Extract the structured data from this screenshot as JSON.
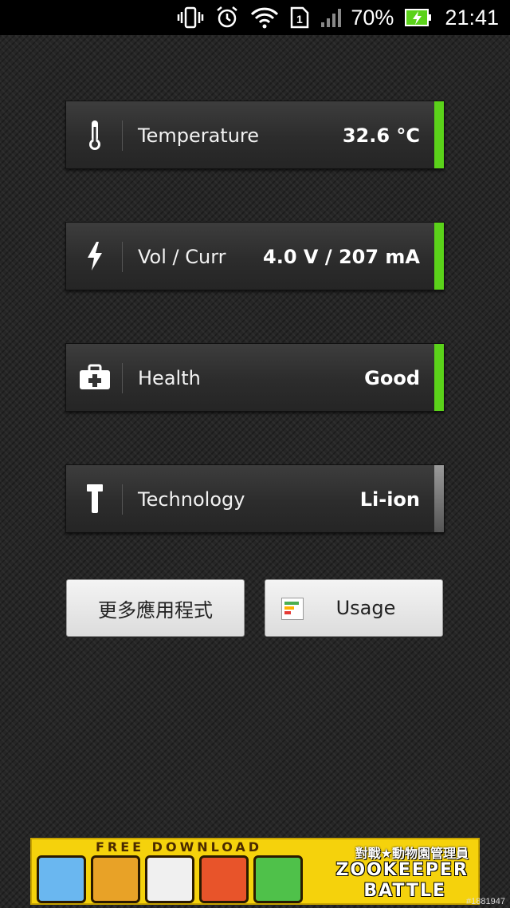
{
  "statusbar": {
    "signal_sim": "1",
    "battery_percent": "70%",
    "clock": "21:41",
    "icons": [
      "vibrate-icon",
      "alarm-icon",
      "wifi-icon",
      "sim-icon",
      "signal-icon",
      "battery-charging-icon"
    ]
  },
  "cards": [
    {
      "label": "Temperature",
      "value": "32.6 °C",
      "icon": "thermometer-icon",
      "bar_color": "#5bd21a"
    },
    {
      "label": "Vol / Curr",
      "value": "4.0 V / 207 mA",
      "icon": "lightning-icon",
      "bar_color": "#5bd21a"
    },
    {
      "label": "Health",
      "value": "Good",
      "icon": "first-aid-icon",
      "bar_color": "#5bd21a"
    },
    {
      "label": "Technology",
      "value": "Li-ion",
      "icon": "hammer-icon",
      "bar_color": "#8a8a8a"
    }
  ],
  "buttons": {
    "more_apps": "更多應用程式",
    "usage": "Usage"
  },
  "ad": {
    "tagline": "FREE DOWNLOAD",
    "title_cn": "對戰★動物園管理員",
    "title_line1": "ZOOKEEPER",
    "title_line2": "BATTLE"
  },
  "watermark": "#1881947"
}
